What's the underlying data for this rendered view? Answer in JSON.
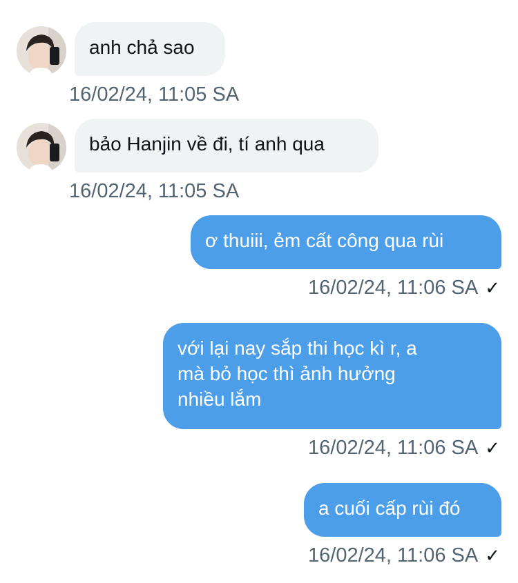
{
  "messages": [
    {
      "side": "in",
      "text": "anh chả sao",
      "time": "16/02/24, 11:05 SA"
    },
    {
      "side": "in",
      "text": "bảo Hanjin về đi, tí anh qua",
      "time": "16/02/24, 11:05 SA"
    },
    {
      "side": "out",
      "text": "ơ thuiii, ẻm cất công qua rùi",
      "time": "16/02/24, 11:06 SA",
      "read_icon": "check-icon"
    },
    {
      "side": "out",
      "text": "với lại nay sắp thi học kì r, a\nmà bỏ học thì ảnh hưởng\nnhiều lắm",
      "time": "16/02/24, 11:06 SA",
      "read_icon": "check-icon"
    },
    {
      "side": "out",
      "text": "a cuối cấp rùi đó",
      "time": "16/02/24, 11:06 SA",
      "read_icon": "check-icon"
    }
  ],
  "check_glyph": "✓",
  "colors": {
    "incoming_bubble": "#eff3f4",
    "outgoing_bubble": "#4c9ee9",
    "timestamp": "#536471"
  }
}
